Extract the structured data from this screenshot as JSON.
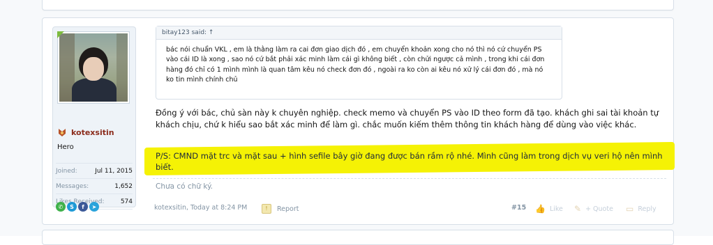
{
  "post": {
    "user": {
      "name": "kotexsitin",
      "title": "Hero",
      "stats": [
        {
          "label": "Joined:",
          "value": "Jul 11, 2015"
        },
        {
          "label": "Messages:",
          "value": "1,652"
        },
        {
          "label": "Likes Received:",
          "value": "574"
        }
      ]
    },
    "quote": {
      "header": "bitay123 said: ↑",
      "body": "bác nói chuẩn VKL , em là thằng làm ra cai đơn giao dịch đó , em chuyển khoản xong cho nó thì nó cứ chuyển PS vào cái ID là xong , sao nó cứ bắt phải xác minh làm cái gì không biết , còn chửi ngược cả mình , trong khi cái đơn hàng đó chỉ có 1 mình mình là quan tâm kêu nó check đơn đó , ngoài ra ko còn ai kêu nó xử lý cái đơn đó , mà nó ko tin mình chính chủ"
    },
    "message": "Đồng ý với bác, chủ sàn này k chuyên nghiệp. check memo và chuyển PS vào ID theo form đã tạo. khách ghi sai tài khoản tự khách chịu, chứ k hiểu sao bắt xác minh để làm gì. chắc muốn kiếm thêm thông tin khách hàng để dùng vào việc khác.",
    "message2": "P/S: CMND mặt trc và mặt sau + hình sefile bây giờ đang được bán rầm rộ nhé. Mình cũng làm trong dịch vụ veri hộ nên mình biết.",
    "signature": "Chưa có chữ ký.",
    "footer": {
      "author_time": "kotexsitin, Today at 8:24 PM",
      "report": "Report",
      "number": "#15",
      "like": "Like",
      "quote": "+ Quote",
      "reply": "Reply"
    }
  },
  "colors": {
    "highlight": "#f5f205",
    "username": "#8b2c1c",
    "muted": "#8394a4"
  }
}
